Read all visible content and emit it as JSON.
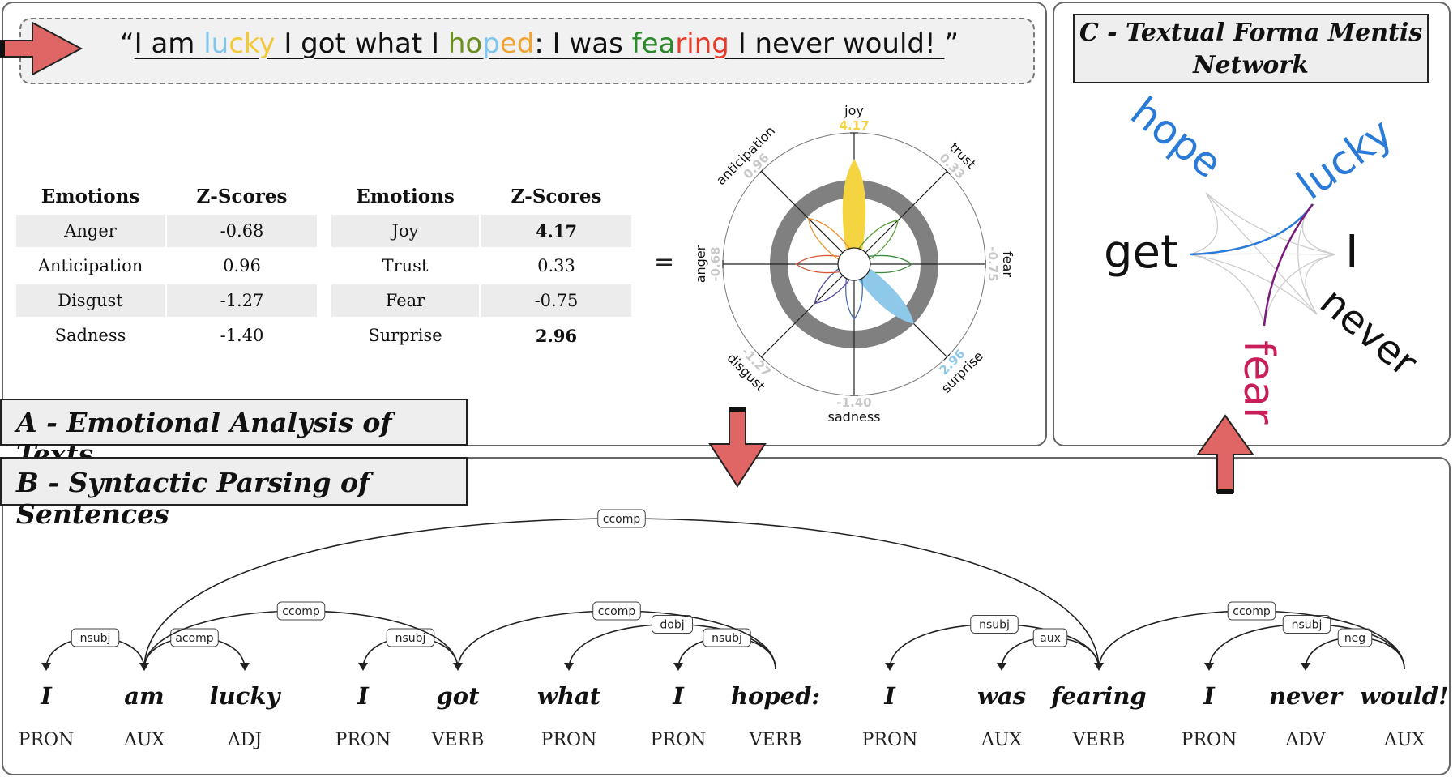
{
  "sentence": {
    "open_quote": "“",
    "segments": [
      {
        "text": "I am ",
        "color": "#111111"
      },
      {
        "text": "lu",
        "color": "#7fc6ea"
      },
      {
        "text": "cky",
        "color": "#f2c93a"
      },
      {
        "text": " I got what I ",
        "color": "#111111"
      },
      {
        "text": "ho",
        "color": "#6a8f1f"
      },
      {
        "text": "p",
        "color": "#7fc6ea"
      },
      {
        "text": "ed",
        "color": "#f0a332"
      },
      {
        "text": ": I was ",
        "color": "#111111"
      },
      {
        "text": "fea",
        "color": "#2a8a2a"
      },
      {
        "text": "ring",
        "color": "#e53c2a"
      },
      {
        "text": " I never would! ",
        "color": "#111111"
      }
    ],
    "close_quote": "”"
  },
  "titles": {
    "a": "A - Emotional Analysis of Texts",
    "b": "B - Syntactic Parsing of Sentences",
    "c_line1": "C - Textual Forma Mentis",
    "c_line2": "Network"
  },
  "table_left": {
    "headers": [
      "Emotions",
      "Z-Scores"
    ],
    "rows": [
      {
        "emotion": "Anger",
        "score": "-0.68"
      },
      {
        "emotion": "Anticipation",
        "score": "0.96"
      },
      {
        "emotion": "Disgust",
        "score": "-1.27"
      },
      {
        "emotion": "Sadness",
        "score": "-1.40"
      }
    ]
  },
  "table_right": {
    "headers": [
      "Emotions",
      "Z-Scores"
    ],
    "rows": [
      {
        "emotion": "Joy",
        "score": "4.17"
      },
      {
        "emotion": "Trust",
        "score": "0.33"
      },
      {
        "emotion": "Fear",
        "score": "-0.75"
      },
      {
        "emotion": "Surprise",
        "score": "2.96"
      }
    ]
  },
  "equals_sign": "=",
  "flower": {
    "emotions": [
      {
        "name": "joy",
        "score": 4.17,
        "label": "4.17",
        "color": "#f5d442",
        "label_color": "#f5d442",
        "significant": true
      },
      {
        "name": "trust",
        "score": 0.33,
        "label": "0.33",
        "color": "#5a9e3a",
        "label_color": "#c8c8c8",
        "significant": false
      },
      {
        "name": "fear",
        "score": -0.75,
        "label": "-0.75",
        "color": "#3f8a3f",
        "label_color": "#c8c8c8",
        "significant": false
      },
      {
        "name": "surprise",
        "score": 2.96,
        "label": "2.96",
        "color": "#8ec9ea",
        "label_color": "#8ec9ea",
        "significant": true
      },
      {
        "name": "sadness",
        "score": -1.4,
        "label": "-1.40",
        "color": "#4a6fb5",
        "label_color": "#c8c8c8",
        "significant": false
      },
      {
        "name": "disgust",
        "score": -1.27,
        "label": "-1.27",
        "color": "#5a4aa0",
        "label_color": "#c8c8c8",
        "significant": false
      },
      {
        "name": "anger",
        "score": -0.68,
        "label": "-0.68",
        "color": "#d9583a",
        "label_color": "#c8c8c8",
        "significant": false
      },
      {
        "name": "anticipation",
        "score": 0.96,
        "label": "0.96",
        "color": "#e8912e",
        "label_color": "#c8c8c8",
        "significant": false
      }
    ],
    "ring_color": "#808080"
  },
  "network": {
    "words": [
      {
        "text": "hope",
        "color": "#2a7ad8"
      },
      {
        "text": "lucky",
        "color": "#2a7ad8"
      },
      {
        "text": "get",
        "color": "#111111"
      },
      {
        "text": "I",
        "color": "#111111"
      },
      {
        "text": "never",
        "color": "#111111"
      },
      {
        "text": "fear",
        "color": "#c81e5a"
      }
    ],
    "positive_edge_color": "#2a7ad8",
    "negative_edge_color": "#7a1a7a",
    "neutral_edge_color": "#cccccc"
  },
  "parse": {
    "tokens": [
      {
        "word": "I",
        "pos": "PRON"
      },
      {
        "word": "am",
        "pos": "AUX"
      },
      {
        "word": "lucky",
        "pos": "ADJ"
      },
      {
        "word": "I",
        "pos": "PRON"
      },
      {
        "word": "got",
        "pos": "VERB"
      },
      {
        "word": "what",
        "pos": "PRON"
      },
      {
        "word": "I",
        "pos": "PRON"
      },
      {
        "word": "hoped:",
        "pos": "VERB"
      },
      {
        "word": "I",
        "pos": "PRON"
      },
      {
        "word": "was",
        "pos": "AUX"
      },
      {
        "word": "fearing",
        "pos": "VERB"
      },
      {
        "word": "I",
        "pos": "PRON"
      },
      {
        "word": "never",
        "pos": "ADV"
      },
      {
        "word": "would!",
        "pos": "AUX"
      }
    ],
    "arcs": [
      {
        "head": 1,
        "dep": 0,
        "label": "nsubj"
      },
      {
        "head": 1,
        "dep": 2,
        "label": "acomp"
      },
      {
        "head": 4,
        "dep": 3,
        "label": "nsubj"
      },
      {
        "head": 4,
        "dep": 1,
        "label": "ccomp"
      },
      {
        "head": 7,
        "dep": 5,
        "label": "dobj"
      },
      {
        "head": 7,
        "dep": 6,
        "label": "nsubj"
      },
      {
        "head": 7,
        "dep": 4,
        "label": "ccomp"
      },
      {
        "head": 10,
        "dep": 8,
        "label": "nsubj"
      },
      {
        "head": 10,
        "dep": 9,
        "label": "aux"
      },
      {
        "head": 10,
        "dep": 1,
        "label": "ccomp"
      },
      {
        "head": 13,
        "dep": 11,
        "label": "nsubj"
      },
      {
        "head": 13,
        "dep": 12,
        "label": "neg"
      },
      {
        "head": 13,
        "dep": 10,
        "label": "ccomp"
      }
    ]
  },
  "arrows": {
    "color": "#e06666",
    "stroke": "#222222"
  }
}
